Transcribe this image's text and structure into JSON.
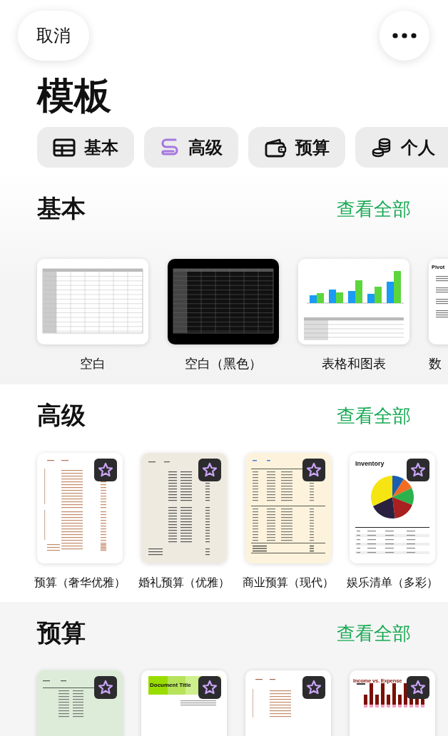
{
  "top_bar": {
    "cancel": "取消"
  },
  "title": "模板",
  "categories": [
    {
      "label": "基本",
      "kind": "table"
    },
    {
      "label": "高级",
      "kind": "swirl"
    },
    {
      "label": "预算",
      "kind": "wallet"
    },
    {
      "label": "个人",
      "kind": "coins"
    }
  ],
  "sections": [
    {
      "title": "基本",
      "see_all": "查看全部",
      "templates": [
        {
          "label": "空白",
          "kind": "grid-light",
          "premium": false
        },
        {
          "label": "空白（黑色）",
          "kind": "grid-dark",
          "premium": false
        },
        {
          "label": "表格和图表",
          "kind": "chart",
          "premium": false
        },
        {
          "label": "数",
          "kind": "pivot",
          "premium": false,
          "heading": "Pivot",
          "partial": true
        }
      ]
    },
    {
      "title": "高级",
      "see_all": "查看全部",
      "templates": [
        {
          "label": "预算（奢华优雅）",
          "kind": "ledger-luxe",
          "premium": true
        },
        {
          "label": "婚礼预算（优雅）",
          "kind": "ledger-wedding",
          "premium": true
        },
        {
          "label": "商业预算（现代）",
          "kind": "ledger-modern",
          "premium": true
        },
        {
          "label": "娱乐清单（多彩）",
          "kind": "inventory",
          "premium": true,
          "heading": "Inventory"
        }
      ]
    },
    {
      "title": "预算",
      "see_all": "查看全部",
      "templates": [
        {
          "kind": "ledger-green",
          "premium": true
        },
        {
          "kind": "document",
          "premium": true,
          "heading": "Document Title"
        },
        {
          "kind": "ledger-plain",
          "premium": true
        },
        {
          "kind": "income",
          "premium": true,
          "heading": "Income vs. Expense"
        }
      ]
    }
  ]
}
